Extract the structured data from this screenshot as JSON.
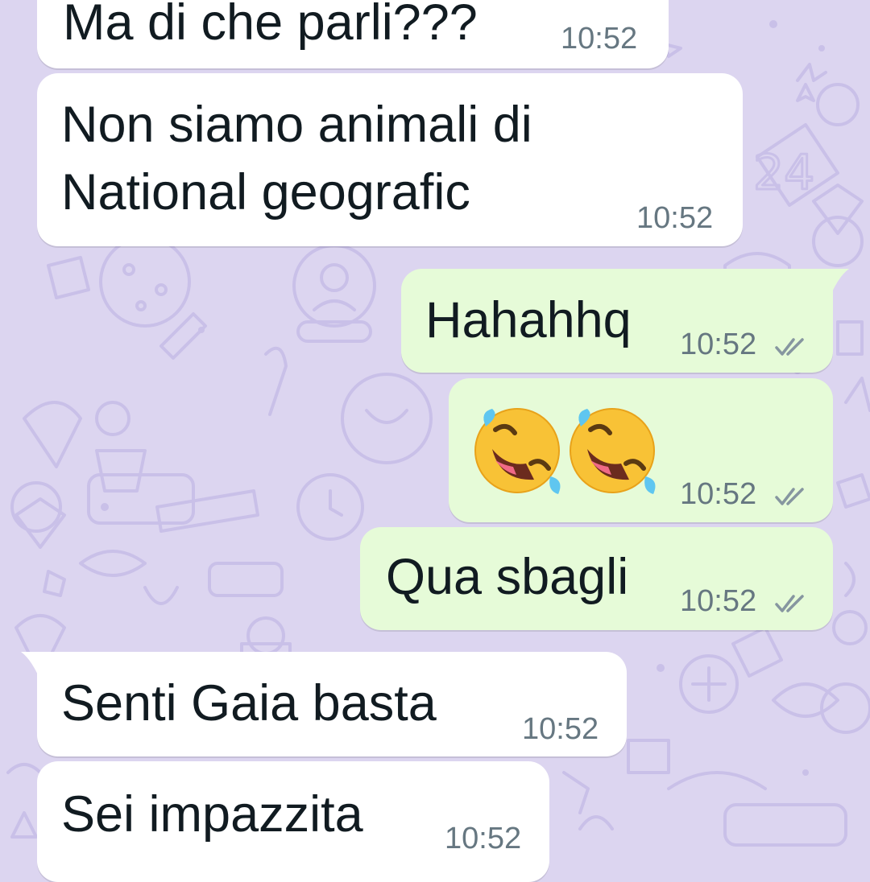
{
  "messages": [
    {
      "id": "m1",
      "direction": "incoming",
      "text": "Ma di che parli???",
      "time": "10:52"
    },
    {
      "id": "m2",
      "direction": "incoming",
      "lines": [
        "Non siamo animali di",
        "National geografic"
      ],
      "time": "10:52"
    },
    {
      "id": "m3",
      "direction": "outgoing",
      "text": "Hahahhq",
      "time": "10:52",
      "status_icon": "double-check-icon"
    },
    {
      "id": "m4",
      "direction": "outgoing",
      "emoji": [
        "rolling-on-floor-laughing-emoji",
        "rolling-on-floor-laughing-emoji"
      ],
      "time": "10:52",
      "status_icon": "double-check-icon"
    },
    {
      "id": "m5",
      "direction": "outgoing",
      "text": "Qua sbagli",
      "time": "10:52",
      "status_icon": "double-check-icon"
    },
    {
      "id": "m6",
      "direction": "incoming",
      "text": "Senti Gaia basta",
      "time": "10:52"
    },
    {
      "id": "m7",
      "direction": "incoming",
      "text": "Sei impazzita",
      "time": "10:52"
    }
  ],
  "colors": {
    "wallpaper": "#dcd5f0",
    "incoming_bubble": "#ffffff",
    "outgoing_bubble": "#e6fbd8",
    "text": "#111b21",
    "timestamp": "#667781"
  }
}
